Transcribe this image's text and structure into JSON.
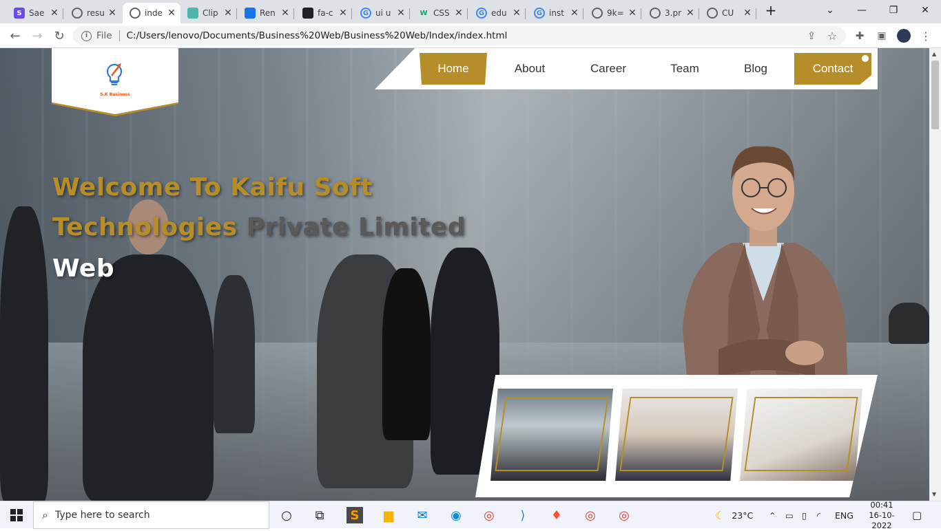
{
  "browser": {
    "tabs": [
      {
        "title": "Sae",
        "icon": "s-purple-icon",
        "color": "#6b4ce6"
      },
      {
        "title": "resu",
        "icon": "globe-icon",
        "color": "#5f6368"
      },
      {
        "title": "inde",
        "icon": "globe-icon",
        "color": "#5f6368",
        "active": true
      },
      {
        "title": "Clip",
        "icon": "clip-icon",
        "color": "#4db6ac"
      },
      {
        "title": "Ren",
        "icon": "render-icon",
        "color": "#1a73e8"
      },
      {
        "title": "fa-c",
        "icon": "flag-icon",
        "color": "#202124"
      },
      {
        "title": "ui u",
        "icon": "google-icon",
        "color": "#4285f4"
      },
      {
        "title": "CSS",
        "icon": "w3-icon",
        "color": "#04aa6d"
      },
      {
        "title": "edu",
        "icon": "google-icon",
        "color": "#4285f4"
      },
      {
        "title": "inst",
        "icon": "google-icon",
        "color": "#4285f4"
      },
      {
        "title": "9k=",
        "icon": "globe-icon",
        "color": "#5f6368"
      },
      {
        "title": "3.pr",
        "icon": "globe-icon",
        "color": "#5f6368"
      },
      {
        "title": "CU",
        "icon": "globe-icon",
        "color": "#5f6368"
      }
    ],
    "new_tab": "+",
    "address": {
      "scheme_label": "File",
      "url": "C:/Users/lenovo/Documents/Business%20Web/Business%20Web/Index/index.html"
    }
  },
  "site": {
    "logo_text": "S.K Business",
    "nav": [
      {
        "label": "Home",
        "active": true
      },
      {
        "label": "About"
      },
      {
        "label": "Career"
      },
      {
        "label": "Team"
      },
      {
        "label": "Blog"
      },
      {
        "label": "Contact",
        "highlight": true
      }
    ],
    "hero": {
      "line1": "Welcome To Kaifu Soft",
      "line2a": "Technologies",
      "line2b": " Private Limited",
      "line3": "Web"
    }
  },
  "taskbar": {
    "search_placeholder": "Type here to search",
    "weather": "23°C",
    "language": "ENG",
    "time": "00:41",
    "date": "16-10-2022"
  },
  "colors": {
    "accent_gold": "#b58e2a"
  }
}
